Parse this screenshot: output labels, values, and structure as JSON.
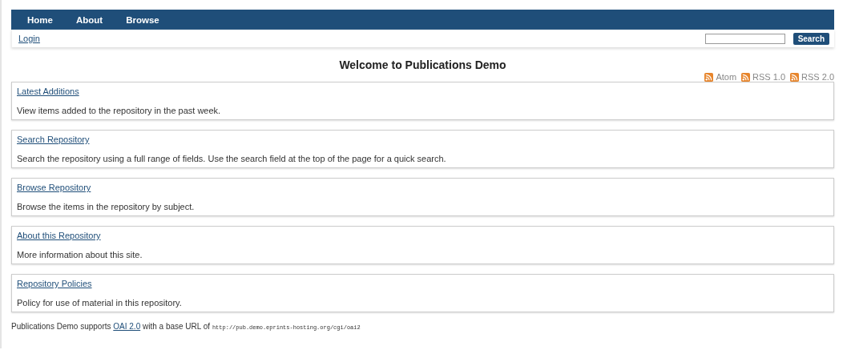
{
  "nav": {
    "items": [
      {
        "label": "Home"
      },
      {
        "label": "About"
      },
      {
        "label": "Browse"
      }
    ]
  },
  "login_bar": {
    "login": "Login",
    "search_button": "Search"
  },
  "title": "Welcome to Publications Demo",
  "feeds": [
    {
      "label": "Atom"
    },
    {
      "label": "RSS 1.0"
    },
    {
      "label": "RSS 2.0"
    }
  ],
  "sections": [
    {
      "link": "Latest Additions",
      "description": "View items added to the repository in the past week."
    },
    {
      "link": "Search Repository",
      "description": "Search the repository using a full range of fields. Use the search field at the top of the page for a quick search."
    },
    {
      "link": "Browse Repository",
      "description": "Browse the items in the repository by subject."
    },
    {
      "link": "About this Repository",
      "description": "More information about this site."
    },
    {
      "link": "Repository Policies",
      "description": "Policy for use of material in this repository."
    }
  ],
  "footer": {
    "before": "Publications Demo supports",
    "link": "OAI 2.0",
    "middle": "with a base URL of",
    "url": "http://pub.demo.eprints-hosting.org/cgi/oai2"
  }
}
